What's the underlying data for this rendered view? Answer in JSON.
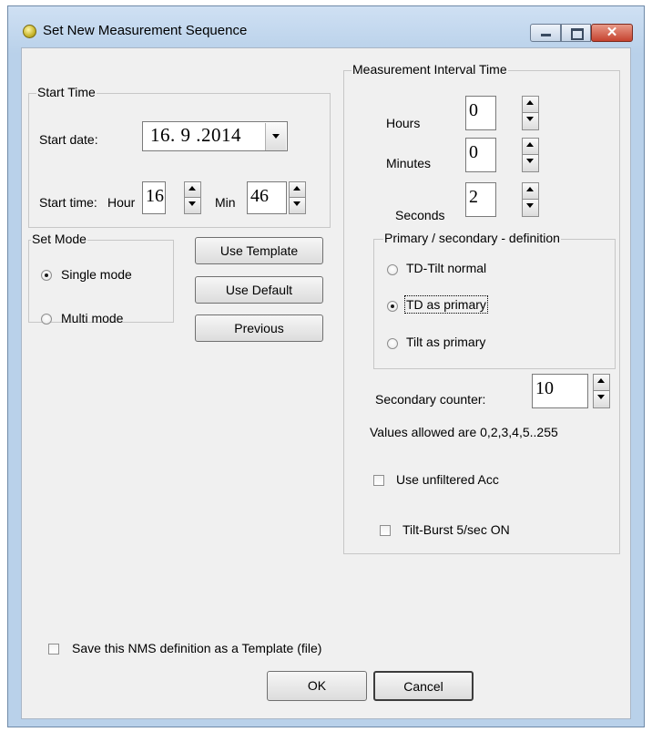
{
  "window": {
    "title": "Set New Measurement Sequence",
    "close_glyph": "✕",
    "icons": {
      "app": "app-icon",
      "minimize": "minimize-icon",
      "maximize": "maximize-icon",
      "close": "close-icon"
    }
  },
  "start_time": {
    "legend": "Start Time",
    "date_label": "Start date:",
    "date_value": "16. 9 .2014",
    "time_label": "Start time:",
    "hour_label": "Hour",
    "hour_value": "16",
    "min_label": "Min",
    "min_value": "46"
  },
  "set_mode": {
    "legend": "Set Mode",
    "options": [
      {
        "label": "Single mode",
        "selected": true
      },
      {
        "label": "Multi mode",
        "selected": false
      }
    ]
  },
  "buttons": {
    "use_template": "Use Template",
    "use_default": "Use Default",
    "previous": "Previous",
    "ok": "OK",
    "cancel": "Cancel"
  },
  "interval": {
    "legend": "Measurement Interval Time",
    "hours_label": "Hours",
    "hours_value": "0",
    "minutes_label": "Minutes",
    "minutes_value": "0",
    "seconds_label": "Seconds",
    "seconds_value": "2"
  },
  "definition": {
    "legend": "Primary / secondary - definition",
    "options": [
      {
        "label": "TD-Tilt normal",
        "selected": false
      },
      {
        "label": "TD as primary",
        "selected": true
      },
      {
        "label": "Tilt as primary",
        "selected": false
      }
    ]
  },
  "secondary": {
    "label": "Secondary counter:",
    "value": "10",
    "allowed_text": "Values allowed are 0,2,3,4,5..255"
  },
  "options": {
    "unfiltered_acc": {
      "label": "Use unfiltered Acc",
      "checked": false
    },
    "tilt_burst": {
      "label": "Tilt-Burst 5/sec ON",
      "checked": false
    },
    "save_template": {
      "label": "Save this NMS definition as a Template (file)",
      "checked": false
    }
  }
}
